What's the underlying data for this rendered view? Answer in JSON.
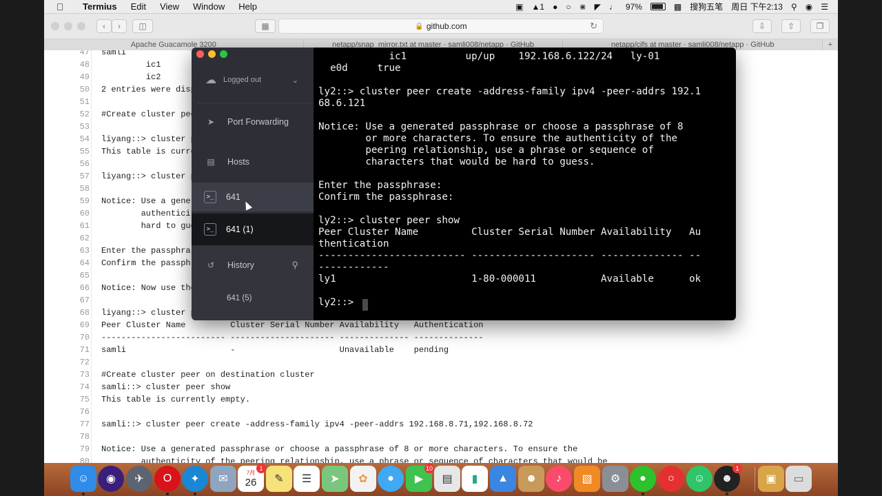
{
  "menubar": {
    "app": "Termius",
    "items": [
      "Edit",
      "View",
      "Window",
      "Help"
    ],
    "badge": "1",
    "battery": "97%",
    "ime": "搜狗五笔",
    "clock": "周日 下午2:13"
  },
  "browser": {
    "url": "github.com",
    "tabs": [
      "Apache Guacamole 3200",
      "netapp/snap_mirror.txt at master · samli008/netapp · GitHub",
      "netapp/cifs at master · samli008/netapp · GitHub"
    ],
    "code_lines": [
      {
        "n": "47",
        "t": "samli"
      },
      {
        "n": "48",
        "t": "         ic1"
      },
      {
        "n": "49",
        "t": "         ic2"
      },
      {
        "n": "50",
        "t": "2 entries were displ"
      },
      {
        "n": "51",
        "t": ""
      },
      {
        "n": "52",
        "t": "#Create cluster peer"
      },
      {
        "n": "53",
        "t": ""
      },
      {
        "n": "54",
        "t": "liyang::> cluster pe"
      },
      {
        "n": "55",
        "t": "This table is curren"
      },
      {
        "n": "56",
        "t": ""
      },
      {
        "n": "57",
        "t": "liyang::> cluster pe"
      },
      {
        "n": "58",
        "t": ""
      },
      {
        "n": "59",
        "t": "Notice: Use a genera"
      },
      {
        "n": "60",
        "t": "        authenticity"
      },
      {
        "n": "61",
        "t": "        hard to gues"
      },
      {
        "n": "62",
        "t": ""
      },
      {
        "n": "63",
        "t": "Enter the passphrase"
      },
      {
        "n": "64",
        "t": "Confirm the passphra"
      },
      {
        "n": "65",
        "t": ""
      },
      {
        "n": "66",
        "t": "Notice: Now use the"
      },
      {
        "n": "67",
        "t": ""
      },
      {
        "n": "68",
        "t": "liyang::> cluster pe"
      },
      {
        "n": "69",
        "t": "Peer Cluster Name         Cluster Serial Number Availability   Authentication"
      },
      {
        "n": "70",
        "t": "------------------------- --------------------- -------------- --------------"
      },
      {
        "n": "71",
        "t": "samli                     -                     Unavailable    pending"
      },
      {
        "n": "72",
        "t": ""
      },
      {
        "n": "73",
        "t": "#Create cluster peer on destination cluster"
      },
      {
        "n": "74",
        "t": "samli::> cluster peer show"
      },
      {
        "n": "75",
        "t": "This table is currently empty."
      },
      {
        "n": "76",
        "t": ""
      },
      {
        "n": "77",
        "t": "samli::> cluster peer create -address-family ipv4 -peer-addrs 192.168.8.71,192.168.8.72"
      },
      {
        "n": "78",
        "t": ""
      },
      {
        "n": "79",
        "t": "Notice: Use a generated passphrase or choose a passphrase of 8 or more characters. To ensure the"
      },
      {
        "n": "80",
        "t": "        authenticity of the peering relationship, use a phrase or sequence of characters that would be"
      }
    ]
  },
  "termius": {
    "account": "Logged out",
    "port_forwarding": "Port Forwarding",
    "hosts": "Hosts",
    "sessions": [
      "641",
      "641 (1)"
    ],
    "history": "History",
    "history_items": [
      "641 (5)"
    ],
    "terminal_text": "            ic1          up/up    192.168.6.122/24   ly-01\n  e0d     true\n\nly2::> cluster peer create -address-family ipv4 -peer-addrs 192.1\n68.6.121\n\nNotice: Use a generated passphrase or choose a passphrase of 8\n        or more characters. To ensure the authenticity of the\n        peering relationship, use a phrase or sequence of\n        characters that would be hard to guess.\n\nEnter the passphrase:\nConfirm the passphrase:\n\nly2::> cluster peer show\nPeer Cluster Name         Cluster Serial Number Availability   Au\nthentication\n------------------------- --------------------- -------------- --\n------------\nly1                       1-80-000011           Available      ok\n\nly2::> "
  },
  "dock": {
    "calendar_day": "26",
    "calendar_month": "7月",
    "badges": {
      "facetime": "10",
      "qq": "1",
      "calendar": "1"
    }
  }
}
